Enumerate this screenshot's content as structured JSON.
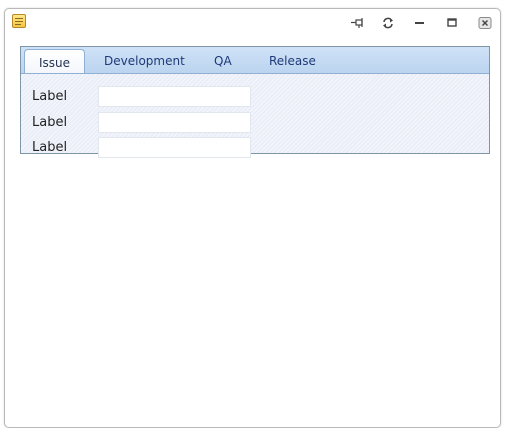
{
  "window": {
    "icon": "notepad-icon",
    "controls": [
      {
        "name": "pin-button",
        "icon": "pin-icon"
      },
      {
        "name": "refresh-button",
        "icon": "refresh-icon"
      },
      {
        "name": "minimize-button",
        "icon": "minimize-icon"
      },
      {
        "name": "maximize-button",
        "icon": "maximize-icon"
      },
      {
        "name": "close-button",
        "icon": "close-icon"
      }
    ]
  },
  "tabs": [
    {
      "label": "Issue",
      "active": true
    },
    {
      "label": "Development",
      "active": false
    },
    {
      "label": "QA",
      "active": false
    },
    {
      "label": "Release",
      "active": false
    }
  ],
  "form": {
    "rows": [
      {
        "label": "Label",
        "value": ""
      },
      {
        "label": "Label",
        "value": ""
      },
      {
        "label": "Label",
        "value": ""
      }
    ]
  },
  "colors": {
    "tab_strip": "#cfe2f7",
    "tab_text": "#1e3a78",
    "panel_background": "#eaeef8",
    "panel_border": "#7e96a8"
  }
}
